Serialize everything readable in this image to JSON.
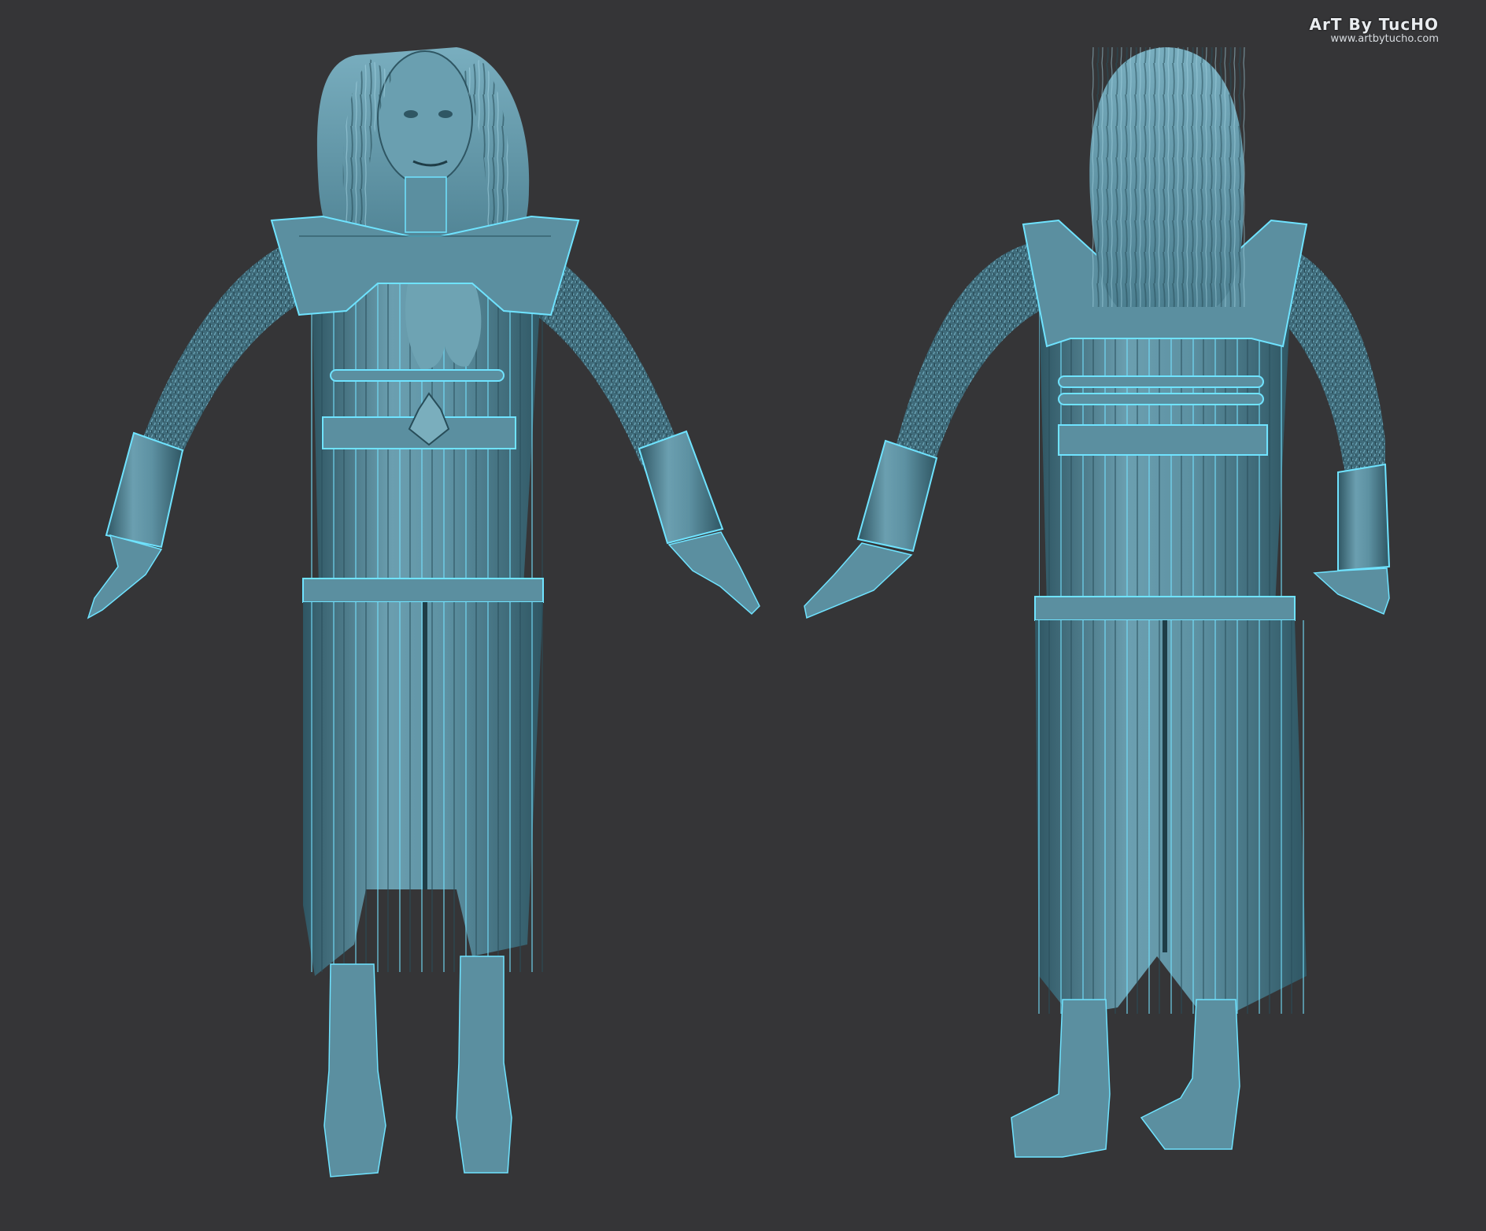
{
  "watermark": {
    "brand": "ArT By TucHO",
    "url": "www.artbytucho.com"
  },
  "figures": [
    {
      "id": "front",
      "view": "front"
    },
    {
      "id": "back",
      "view": "back"
    }
  ],
  "colors": {
    "background": "#353537",
    "model_base": "#5b8fa0",
    "model_light": "#8fc3d2",
    "model_shadow": "#2f5663",
    "highlight_line": "#6fe3ff"
  }
}
